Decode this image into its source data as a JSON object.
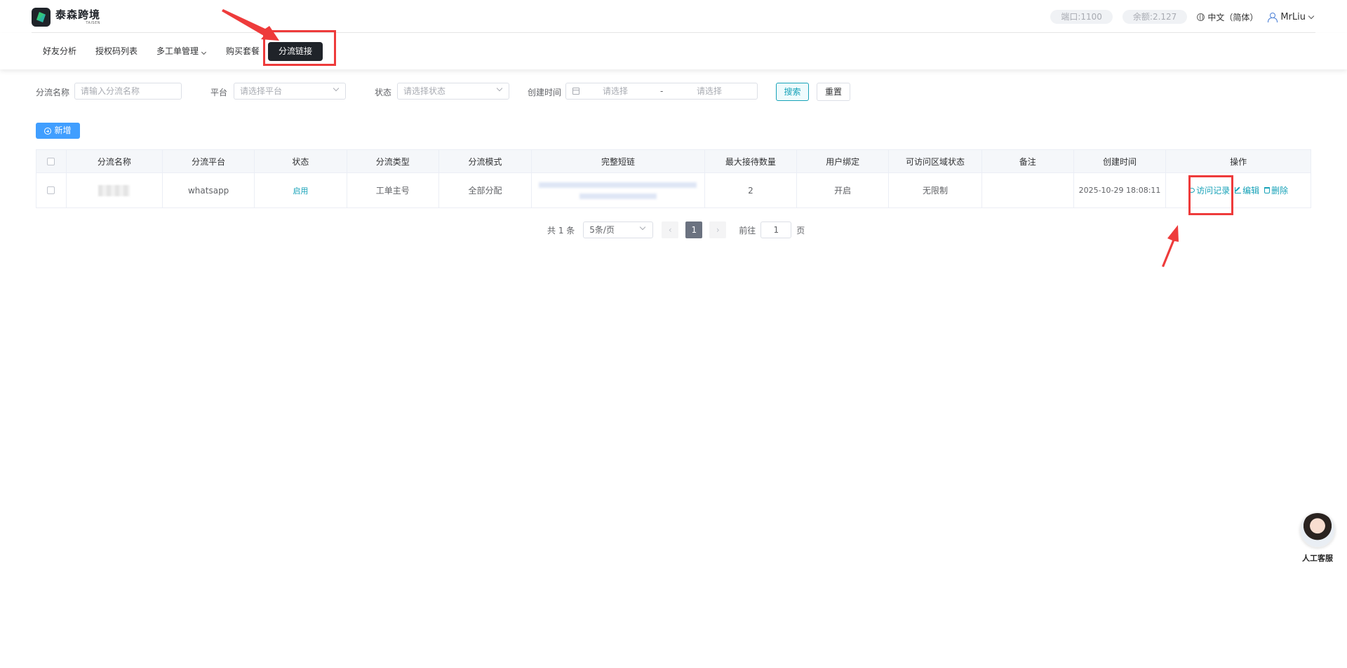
{
  "header": {
    "brand_name": "泰森跨境",
    "brand_sub": "TAISEN",
    "port": "端口:1100",
    "balance": "余额:2.127",
    "language": "中文（简体）",
    "username": "MrLiu"
  },
  "nav": {
    "items": [
      "好友分析",
      "授权码列表",
      "多工单管理",
      "购买套餐",
      "分流链接"
    ],
    "active": "分流链接"
  },
  "filters": {
    "name_label": "分流名称",
    "name_placeholder": "请输入分流名称",
    "platform_label": "平台",
    "platform_placeholder": "请选择平台",
    "status_label": "状态",
    "status_placeholder": "请选择状态",
    "created_label": "创建时间",
    "start_placeholder": "请选择",
    "range_sep": "-",
    "end_placeholder": "请选择",
    "search_label": "搜索",
    "reset_label": "重置"
  },
  "toolbar": {
    "add_label": "新增"
  },
  "table": {
    "columns": [
      "分流名称",
      "分流平台",
      "状态",
      "分流类型",
      "分流模式",
      "完整短链",
      "最大接待数量",
      "用户绑定",
      "可访问区域状态",
      "备注",
      "创建时间",
      "操作"
    ],
    "rows": [
      {
        "name": "",
        "platform": "whatsapp",
        "status": "启用",
        "type": "工单主号",
        "mode": "全部分配",
        "link": "",
        "max_reception": "2",
        "user_binding": "开启",
        "region_status": "无限制",
        "note": "",
        "created": "2025-10-29 18:08:11",
        "actions": {
          "visit": "访问记录",
          "edit": "编辑",
          "delete": "删除"
        }
      }
    ]
  },
  "pagination": {
    "total": "共 1 条",
    "page_size": "5条/页",
    "current_page": "1",
    "goto_label": "前往",
    "goto_value": "1",
    "page_unit": "页"
  },
  "support": {
    "label": "人工客服"
  },
  "colors": {
    "accent": "#17a2b8",
    "primary": "#409eff",
    "annotation": "#ee3b3b",
    "nav_active": "#1f2329"
  }
}
